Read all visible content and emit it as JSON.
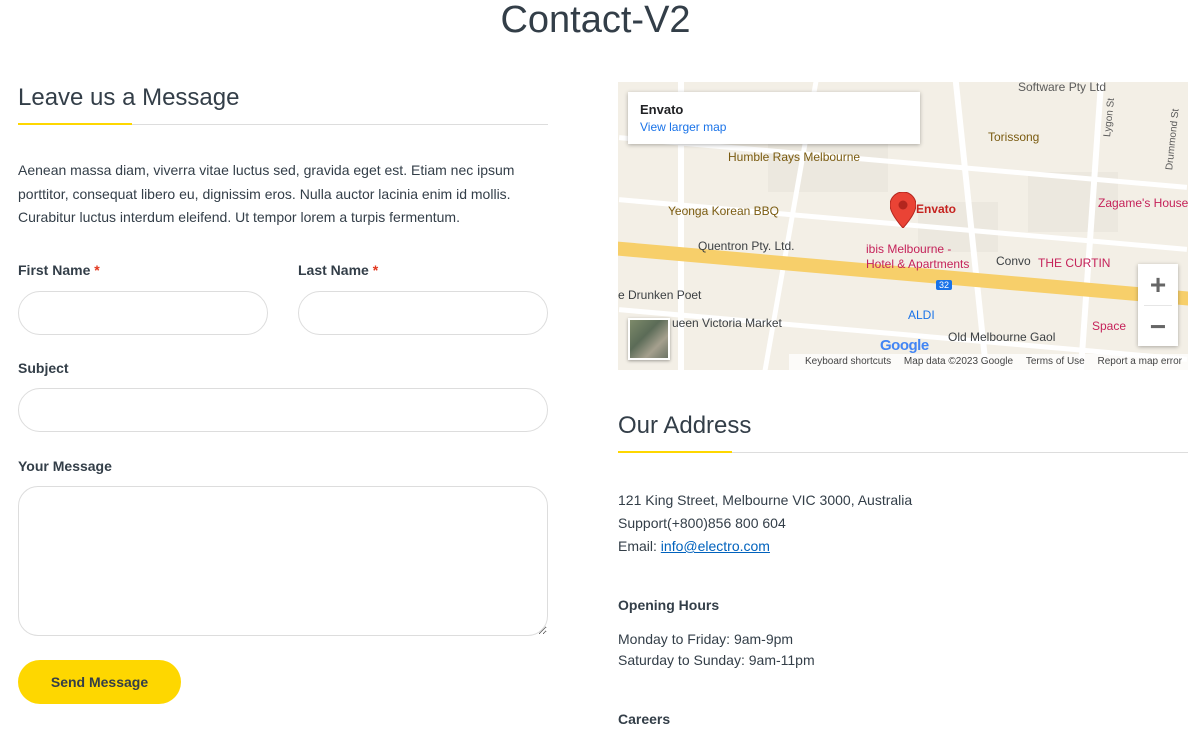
{
  "page": {
    "title": "Contact-V2"
  },
  "form": {
    "heading": "Leave us a Message",
    "intro": "Aenean massa diam, viverra vitae luctus sed, gravida eget est. Etiam nec ipsum porttitor, consequat libero eu, dignissim eros. Nulla auctor lacinia enim id mollis. Curabitur luctus interdum eleifend. Ut tempor lorem a turpis fermentum.",
    "first_name_label": "First Name",
    "last_name_label": "Last Name",
    "required_mark": "*",
    "subject_label": "Subject",
    "message_label": "Your Message",
    "first_name_value": "",
    "last_name_value": "",
    "subject_value": "",
    "message_value": "",
    "send_label": "Send Message"
  },
  "map": {
    "place_name": "Envato",
    "larger_map_link": "View larger map",
    "labels": {
      "software": "Software Pty Ltd",
      "lygon": "Lygon St",
      "drummond": "Drummond St",
      "torissong": "Torissong",
      "humble": "Humble Rays Melbourne",
      "zagame": "Zagame's House",
      "envato": "Envato",
      "yeonga": "Yeonga Korean BBQ",
      "quentron": "Quentron Pty. Ltd.",
      "ibis": "ibis Melbourne -",
      "ibis2": "Hotel & Apartments",
      "convo": "Convo",
      "curtin": "THE CURTIN",
      "drunken": "e Drunken Poet",
      "qvm": "ueen Victoria Market",
      "aldi": "ALDI",
      "gaol": "Old Melbourne Gaol",
      "space": "Space",
      "route": "32"
    },
    "zoom_in": "+",
    "zoom_out": "−",
    "google_logo": "Google",
    "attribution": {
      "shortcuts": "Keyboard shortcuts",
      "data": "Map data ©2023 Google",
      "terms": "Terms of Use",
      "report": "Report a map error"
    }
  },
  "address": {
    "heading": "Our Address",
    "line1": "121 King Street, Melbourne VIC 3000, Australia",
    "line2": "Support(+800)856 800 604",
    "email_label": "Email: ",
    "email": "info@electro.com",
    "hours_heading": "Opening Hours",
    "hours_weekday": "Monday to Friday: 9am-9pm",
    "hours_weekend": "Saturday to Sunday: 9am-11pm",
    "careers_heading": "Careers"
  },
  "colors": {
    "accent": "#fed700",
    "text": "#333e48",
    "required": "#e2361d",
    "link": "#0062bd"
  }
}
